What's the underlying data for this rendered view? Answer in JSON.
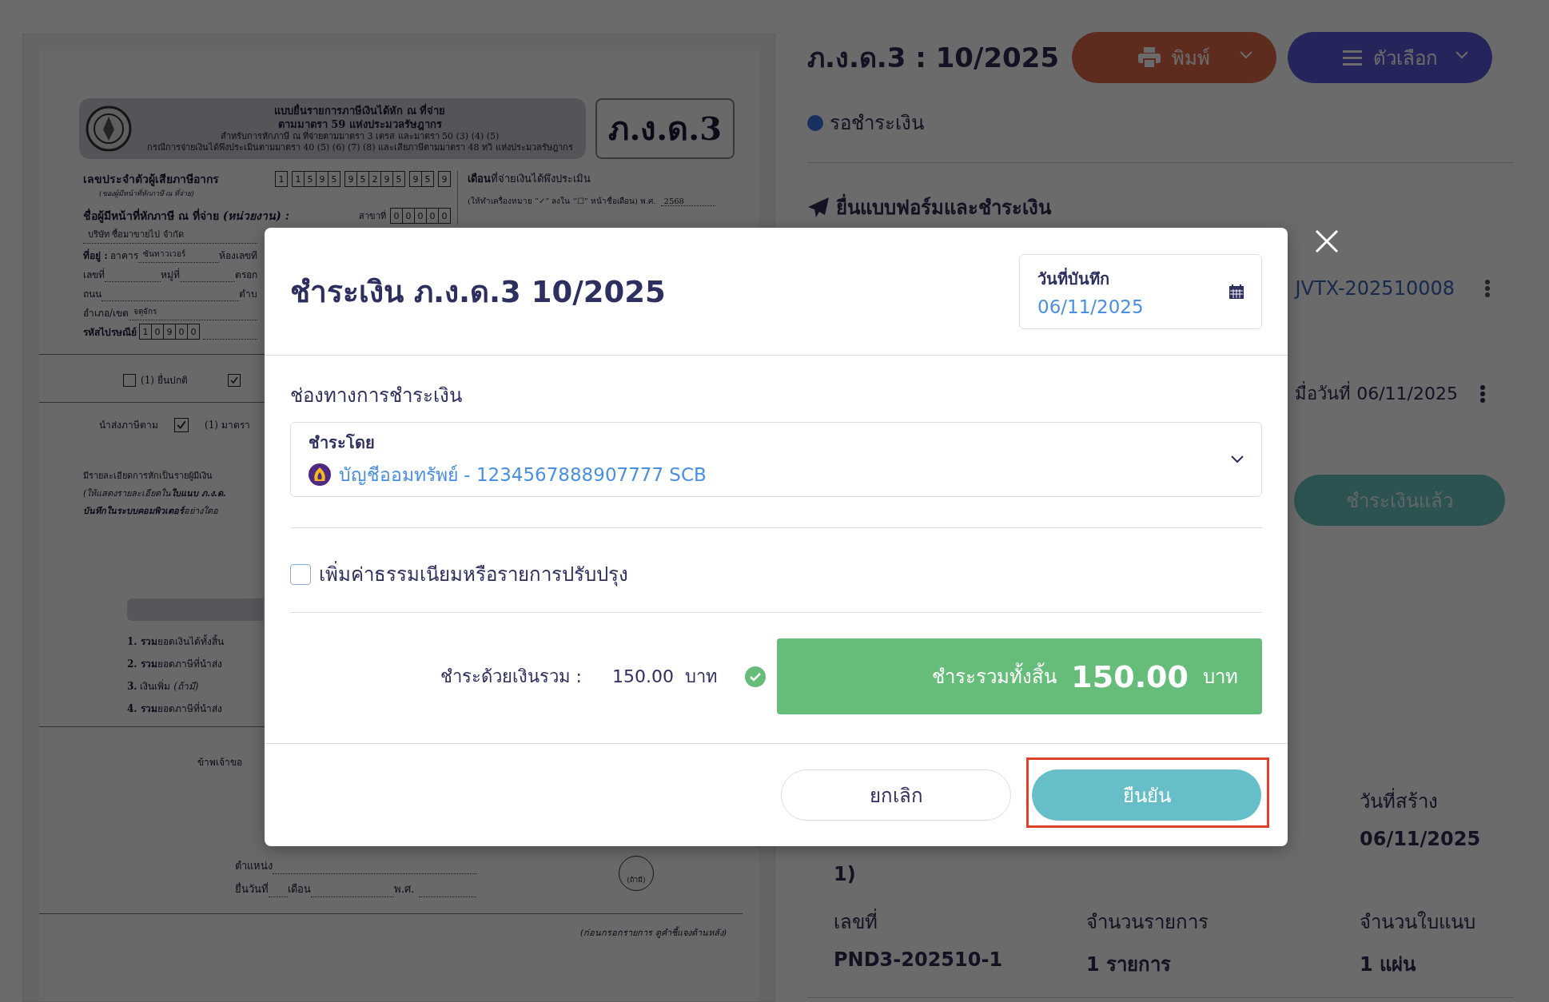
{
  "document": {
    "header_lines": [
      "แบบยื่นรายการภาษีเงินได้หัก ณ ที่จ่าย",
      "ตามมาตรา 59 แห่งประมวลรัษฎากร",
      "สำหรับการหักภาษี ณ ที่จ่ายตามมาตรา 3 เตรส และมาตรา 50 (3) (4) (5)",
      "กรณีการจ่ายเงินได้พึงประเมินตามมาตรา 40 (5) (6) (7) (8) และเสียภาษีตามมาตรา 48 ทวิ แห่งประมวลรัษฎากร"
    ],
    "form_code": "ภ.ง.ด.3",
    "taxpayer_id": {
      "label": "เลขประจำตัวผู้เสียภาษีอากร",
      "note": "(ของผู้มีหน้าที่หักภาษี ณ ที่จ่าย)",
      "digit_groups": [
        [
          "1"
        ],
        [
          "1",
          "5",
          "9",
          "5"
        ],
        [
          "9",
          "5",
          "2",
          "9",
          "5"
        ],
        [
          "9",
          "5"
        ],
        [
          "9"
        ]
      ]
    },
    "month": {
      "label": "**เดือน**ที่จ่ายเงินได้พึงประเมิน",
      "note": "(ให้ทำเครื่องหมาย “✓” ลงใน “☐” หน้าชื่อเดือน) พ.ศ.",
      "year": "2568"
    },
    "payer": {
      "label": "**ชื่อผู้มีหน้าที่หักภาษี ณ ที่จ่าย** *(หน่วยงาน) :*",
      "branch_label": "สาขาที่",
      "branch_digits": [
        "0",
        "0",
        "0",
        "0",
        "0"
      ],
      "name": "บริษัท ซื้อมาขายไป จำกัด"
    },
    "address_rows": [
      [
        {
          "kind": "label",
          "text": "**ที่อยู่ :** อาคาร"
        },
        {
          "kind": "value",
          "text": "ซันทาวเวอร์"
        },
        {
          "kind": "label",
          "text": "ห้องเลขที"
        }
      ],
      [
        {
          "kind": "label",
          "text": "เลขที่"
        },
        {
          "kind": "value",
          "text": ""
        },
        {
          "kind": "label",
          "text": "หมู่ที่"
        },
        {
          "kind": "value",
          "text": ""
        },
        {
          "kind": "label",
          "text": "ตรอก"
        }
      ],
      [
        {
          "kind": "label",
          "text": "ถนน"
        },
        {
          "kind": "value",
          "text": ""
        },
        {
          "kind": "label",
          "text": "ตำบ"
        }
      ],
      [
        {
          "kind": "label",
          "text": "อำเภอ/เขต"
        },
        {
          "kind": "value",
          "text": "จตุจักร"
        }
      ]
    ],
    "postal": {
      "label": "รหัสไปรษณีย์",
      "digits": [
        "1",
        "0",
        "9",
        "0",
        "0"
      ]
    },
    "filing_options": [
      {
        "label": "(1) ยื่นปกติ",
        "checked": false
      },
      {
        "checked": true
      }
    ],
    "remit": {
      "label": "นำส่งภาษีตาม",
      "option": "(1)  มาตรา",
      "checked": true
    },
    "details": [
      "มีรายละเอียดการหักเป็นรายผู้มีเงิน",
      "(ให้แสดงรายละเอียดใน**ใบแนบ ภ.ง.ด.**",
      "**บันทึกในระบบคอมพิวเตอร์**อย่างใดอ"
    ],
    "summary_items": [
      "**1. รวม**ยอดเงินได้ทั้งสิ้น",
      "**2. รวม**ยอดภาษีที่นำส่ง",
      "**3.** เงินเพิ่ม *(ถ้ามี)*",
      "**4. รวม**ยอดภาษีที่นำส่ง"
    ],
    "declaration": "ข้าพเจ้าขอ",
    "signature": {
      "position": "ตำแหน่ง",
      "filed": "ยื่นวันที่",
      "month": "เดือน",
      "year": "พ.ศ.",
      "stamp": "(ถ้ามี)"
    },
    "footnote": "(ก่อนกรอกรายการ ดูคำชี้แจงด้านหลัง)"
  },
  "detail": {
    "title": "ภ.ง.ด.3 : 10/2025",
    "print_button": "พิมพ์",
    "options_button": "ตัวเลือก",
    "status": "รอชำระเงิน",
    "section_title": "ยื่นแบบฟอร์มและชำระเงิน",
    "reference": "JVTX-202510008",
    "paid_date": "มื่อวันที่ 06/11/2025",
    "paid_button": "ชำระเงินแล้ว",
    "created_label": "วันที่สร้าง",
    "created_value": "06/11/2025",
    "fragment": "1)",
    "fields": [
      {
        "label": "เลขที่",
        "value": "PND3-202510-1"
      },
      {
        "label": "จำนวนรายการ",
        "value": "1 รายการ"
      },
      {
        "label": "จำนวนใบแนบ",
        "value": "1 แผ่น"
      }
    ]
  },
  "modal": {
    "title": "ชำระเงิน ภ.ง.ด.3 10/2025",
    "date_field": {
      "label": "วันที่บันทึก",
      "value": "06/11/2025"
    },
    "channel_label": "ช่องทางการชำระเงิน",
    "pay_by": {
      "label": "ชำระโดย",
      "value": "บัญชีออมทรัพย์ - 1234567888907777 SCB"
    },
    "adjustment": {
      "label": "เพิ่มค่าธรรมเนียมหรือรายการปรับปรุง",
      "checked": false
    },
    "paid_total_label": "ชำระด้วยเงินรวม :",
    "paid_total_amount": "150.00",
    "paid_total_unit": "บาท",
    "grand_total": {
      "label": "ชำระรวมทั้งสิ้น",
      "amount": "150.00",
      "unit": "บาท"
    },
    "cancel_button": "ยกเลิก",
    "confirm_button": "ยืนยัน",
    "confirm_highlighted": true
  }
}
